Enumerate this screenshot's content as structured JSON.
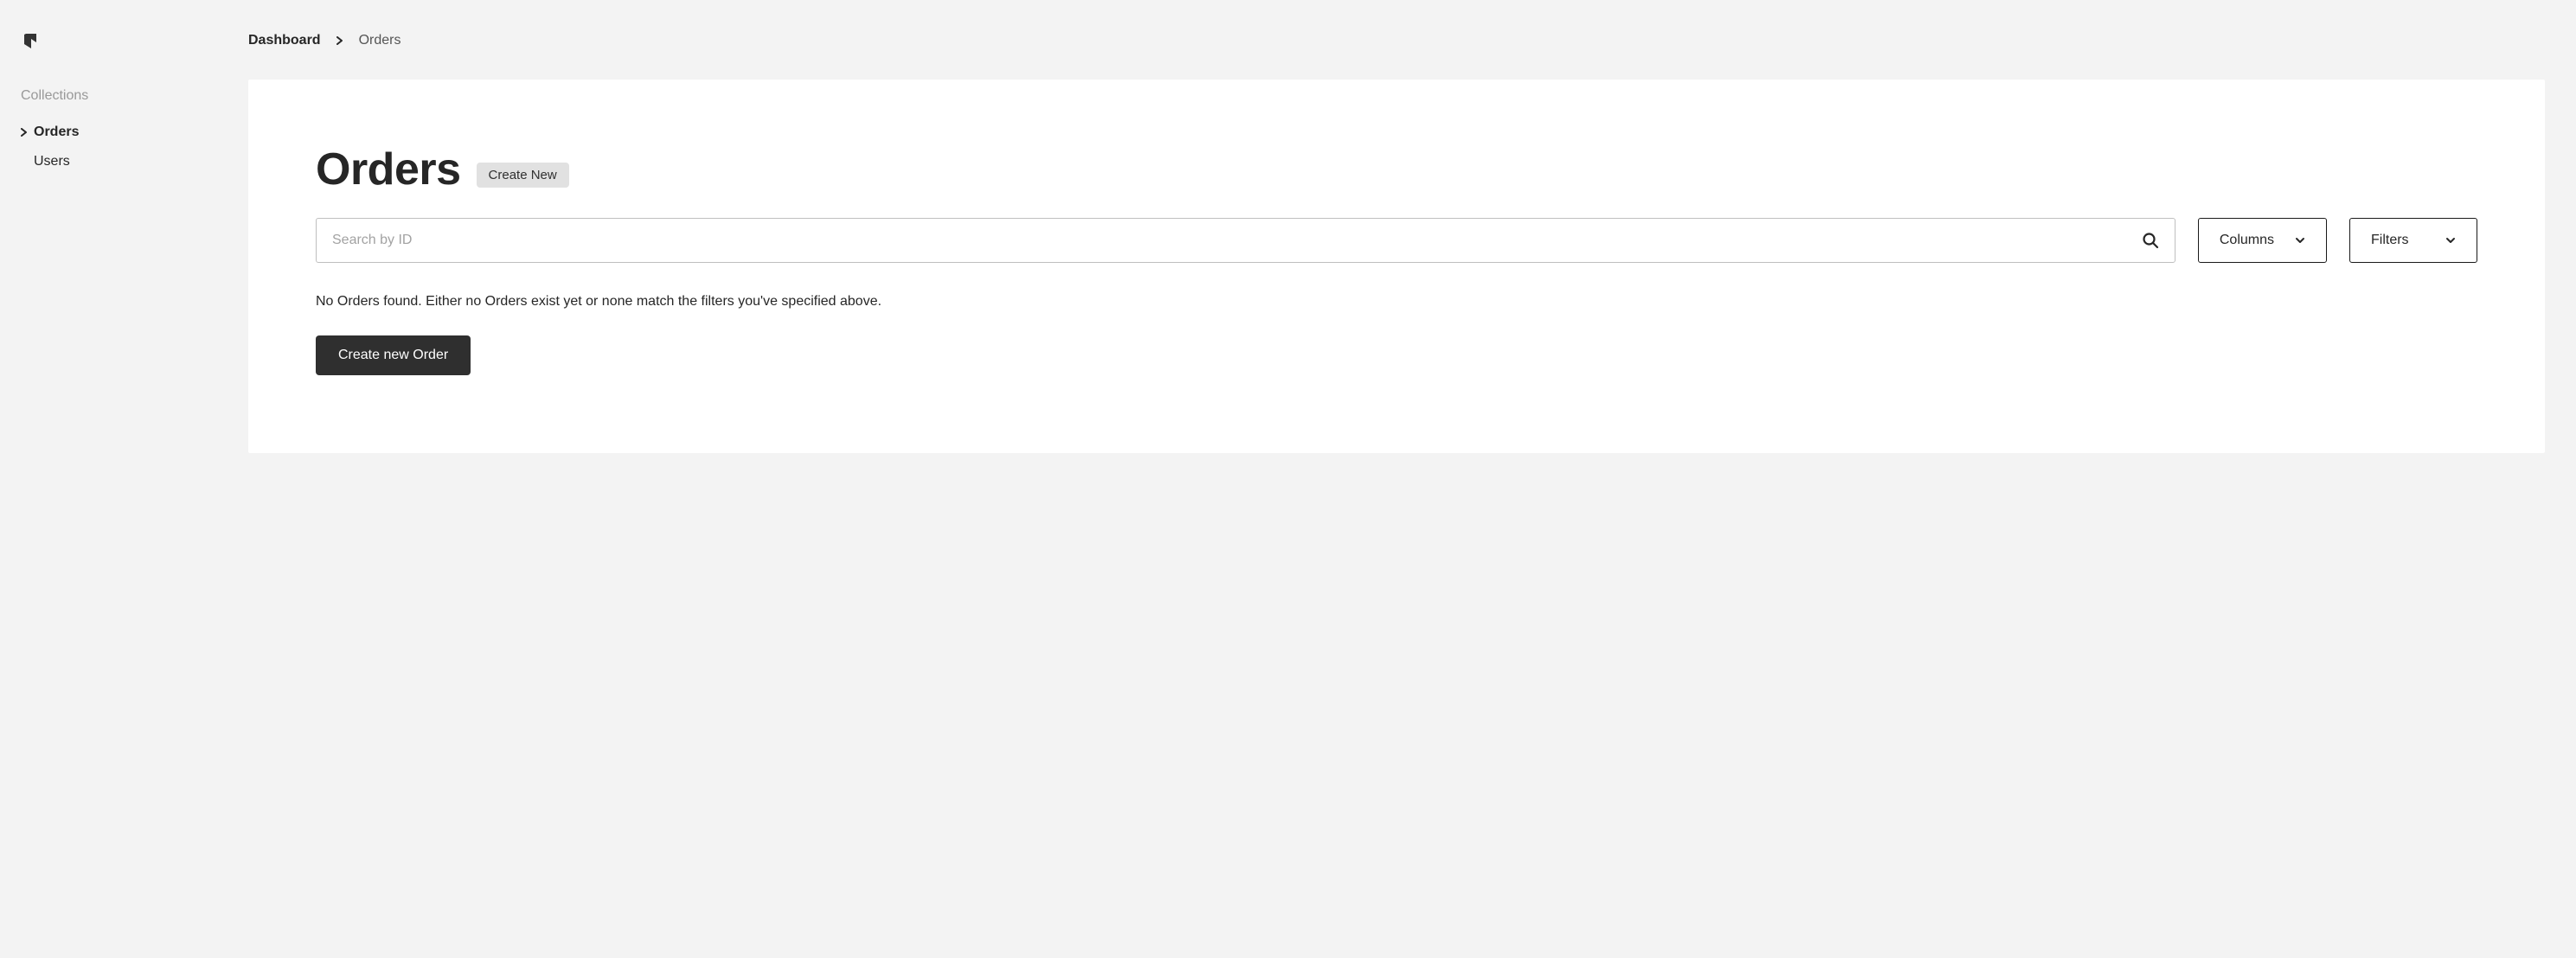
{
  "sidebar": {
    "heading": "Collections",
    "items": [
      {
        "label": "Orders",
        "active": true
      },
      {
        "label": "Users",
        "active": false
      }
    ]
  },
  "breadcrumb": {
    "root": "Dashboard",
    "current": "Orders"
  },
  "page": {
    "title": "Orders",
    "create_pill_label": "Create New",
    "search_placeholder": "Search by ID",
    "columns_button_label": "Columns",
    "filters_button_label": "Filters",
    "empty_message": "No Orders found. Either no Orders exist yet or none match the filters you've specified above.",
    "create_button_label": "Create new Order"
  }
}
